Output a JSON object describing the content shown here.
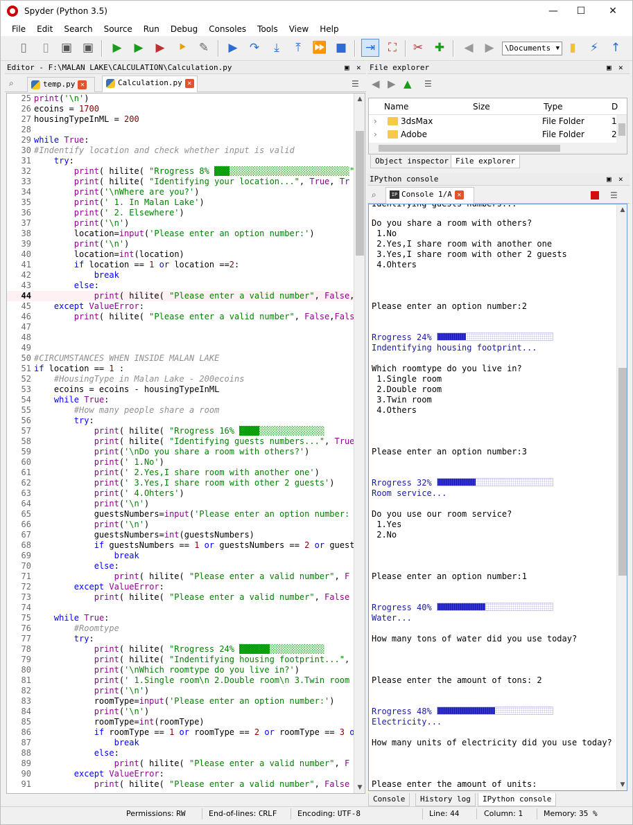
{
  "window": {
    "title": "Spyder (Python 3.5)"
  },
  "menu": [
    "File",
    "Edit",
    "Search",
    "Source",
    "Run",
    "Debug",
    "Consoles",
    "Tools",
    "View",
    "Help"
  ],
  "toolbar": {
    "path_value": "\\Documents"
  },
  "editor": {
    "pane_title": "Editor - F:\\MALAN LAKE\\CALCULATION\\Calculation.py",
    "tabs": [
      {
        "label": "temp.py"
      },
      {
        "label": "Calculation.py"
      }
    ],
    "current_line": 44,
    "lines": [
      {
        "n": "25",
        "html": "<span style='color:#900090'>print</span>(<span style='color:#008000'>'\\n'</span>)"
      },
      {
        "n": "26",
        "html": "ecoins = <span style='color:#800000'>1700</span>"
      },
      {
        "n": "27",
        "html": "housingTypeInML = <span style='color:#800000'>200</span>"
      },
      {
        "n": "28",
        "html": ""
      },
      {
        "n": "29",
        "html": "<span style='color:#0000ff'>while</span> <span style='color:#900090'>True</span>:"
      },
      {
        "n": "30",
        "html": "<span style='color:#909090;font-style:italic'>#Indentify location and check whether input is valid</span>"
      },
      {
        "n": "31",
        "html": "    <span style='color:#0000ff'>try</span>:"
      },
      {
        "n": "32",
        "html": "        <span style='color:#900090'>print</span>( hilite( <span style='color:#008000'>\"Rrogress 8% <span style='background:#19c019'>▒▒▒</span><span style='background:#d6f3d6'>░░░░░░░░░░░░░░░░░░░░░░░░</span>\"</span>, <span style='color:#900090'>T</span>"
      },
      {
        "n": "33",
        "html": "        <span style='color:#900090'>print</span>( hilite( <span style='color:#008000'>\"Identifying your location...\"</span>, <span style='color:#900090'>True</span>, <span style='color:#900090'>Tr</span>"
      },
      {
        "n": "34",
        "html": "        <span style='color:#900090'>print</span>(<span style='color:#008000'>'\\nWhere are you?'</span>)"
      },
      {
        "n": "35",
        "html": "        <span style='color:#900090'>print</span>(<span style='color:#008000'>' 1. In Malan Lake'</span>)"
      },
      {
        "n": "36",
        "html": "        <span style='color:#900090'>print</span>(<span style='color:#008000'>' 2. Elsewhere'</span>)"
      },
      {
        "n": "37",
        "html": "        <span style='color:#900090'>print</span>(<span style='color:#008000'>'\\n'</span>)"
      },
      {
        "n": "38",
        "html": "        location=<span style='color:#900090'>input</span>(<span style='color:#008000'>'Please enter an option number:'</span>)"
      },
      {
        "n": "39",
        "html": "        <span style='color:#900090'>print</span>(<span style='color:#008000'>'\\n'</span>)"
      },
      {
        "n": "40",
        "html": "        location=<span style='color:#900090'>int</span>(location)"
      },
      {
        "n": "41",
        "html": "        <span style='color:#0000ff'>if</span> location == <span style='color:#800000'>1</span> <span style='color:#0000ff'>or</span> location ==<span style='color:#800000'>2</span>:"
      },
      {
        "n": "42",
        "html": "            <span style='color:#0000ff'>break</span>"
      },
      {
        "n": "43",
        "html": "        <span style='color:#0000ff'>else</span>:"
      },
      {
        "n": "44",
        "html": "            <span style='color:#900090'>print</span>( hilite( <span style='color:#008000'>\"Please enter a valid number\"</span>, <span style='color:#900090'>False</span>,"
      },
      {
        "n": "45",
        "html": "    <span style='color:#0000ff'>except</span> <span style='color:#900090'>ValueError</span>:"
      },
      {
        "n": "46",
        "html": "        <span style='color:#900090'>print</span>( hilite( <span style='color:#008000'>\"Please enter a valid number\"</span>, <span style='color:#900090'>False</span>,<span style='color:#900090'>Fals</span>"
      },
      {
        "n": "47",
        "html": ""
      },
      {
        "n": "48",
        "html": ""
      },
      {
        "n": "49",
        "html": ""
      },
      {
        "n": "50",
        "html": "<span style='color:#909090;font-style:italic'>#CIRCUMSTANCES WHEN INSIDE MALAN LAKE</span>"
      },
      {
        "n": "51",
        "html": "<span style='color:#0000ff'>if</span> location == <span style='color:#800000'>1</span> :"
      },
      {
        "n": "52",
        "html": "    <span style='color:#909090;font-style:italic'>#HousingType in Malan Lake - 200ecoins</span>"
      },
      {
        "n": "53",
        "html": "    ecoins = ecoins - housingTypeInML"
      },
      {
        "n": "54",
        "html": "    <span style='color:#0000ff'>while</span> <span style='color:#900090'>True</span>:"
      },
      {
        "n": "55",
        "html": "        <span style='color:#909090;font-style:italic'>#How many people share a room</span>"
      },
      {
        "n": "56",
        "html": "        <span style='color:#0000ff'>try</span>:"
      },
      {
        "n": "57",
        "html": "            <span style='color:#900090'>print</span>( hilite( <span style='color:#008000'>\"Rrogress 16% <span style='background:#19c019'>▒▒▒▒</span><span style='background:#d6f3d6'>░░░░░░░░░░░░░</span></span>"
      },
      {
        "n": "58",
        "html": "            <span style='color:#900090'>print</span>( hilite( <span style='color:#008000'>\"Identifying guests numbers...\"</span>, <span style='color:#900090'>True</span>"
      },
      {
        "n": "59",
        "html": "            <span style='color:#900090'>print</span>(<span style='color:#008000'>'\\nDo you share a room with others?'</span>)"
      },
      {
        "n": "60",
        "html": "            <span style='color:#900090'>print</span>(<span style='color:#008000'>' 1.No'</span>)"
      },
      {
        "n": "61",
        "html": "            <span style='color:#900090'>print</span>(<span style='color:#008000'>' 2.Yes,I share room with another one'</span>)"
      },
      {
        "n": "62",
        "html": "            <span style='color:#900090'>print</span>(<span style='color:#008000'>' 3.Yes,I share room with other 2 guests'</span>)"
      },
      {
        "n": "63",
        "html": "            <span style='color:#900090'>print</span>(<span style='color:#008000'>' 4.Ohters'</span>)"
      },
      {
        "n": "64",
        "html": "            <span style='color:#900090'>print</span>(<span style='color:#008000'>'\\n'</span>)"
      },
      {
        "n": "65",
        "html": "            guestsNumbers=<span style='color:#900090'>input</span>(<span style='color:#008000'>'Please enter an option number:</span>"
      },
      {
        "n": "66",
        "html": "            <span style='color:#900090'>print</span>(<span style='color:#008000'>'\\n'</span>)"
      },
      {
        "n": "67",
        "html": "            guestsNumbers=<span style='color:#900090'>int</span>(guestsNumbers)"
      },
      {
        "n": "68",
        "html": "            <span style='color:#0000ff'>if</span> guestsNumbers == <span style='color:#800000'>1</span> <span style='color:#0000ff'>or</span> guestsNumbers == <span style='color:#800000'>2</span> <span style='color:#0000ff'>or</span> guest"
      },
      {
        "n": "69",
        "html": "                <span style='color:#0000ff'>break</span>"
      },
      {
        "n": "70",
        "html": "            <span style='color:#0000ff'>else</span>:"
      },
      {
        "n": "71",
        "html": "                <span style='color:#900090'>print</span>( hilite( <span style='color:#008000'>\"Please enter a valid number\"</span>, <span style='color:#900090'>F</span>"
      },
      {
        "n": "72",
        "html": "        <span style='color:#0000ff'>except</span> <span style='color:#900090'>ValueError</span>:"
      },
      {
        "n": "73",
        "html": "            <span style='color:#900090'>print</span>( hilite( <span style='color:#008000'>\"Please enter a valid number\"</span>, <span style='color:#900090'>False</span>"
      },
      {
        "n": "74",
        "html": ""
      },
      {
        "n": "75",
        "html": "    <span style='color:#0000ff'>while</span> <span style='color:#900090'>True</span>:"
      },
      {
        "n": "76",
        "html": "        <span style='color:#909090;font-style:italic'>#Roomtype</span>"
      },
      {
        "n": "77",
        "html": "        <span style='color:#0000ff'>try</span>:"
      },
      {
        "n": "78",
        "html": "            <span style='color:#900090'>print</span>( hilite( <span style='color:#008000'>\"Rrogress 24% <span style='background:#19c019'>▒▒▒▒▒▒</span><span style='background:#d6f3d6'>░░░░░░░░░░░</span></span>"
      },
      {
        "n": "79",
        "html": "            <span style='color:#900090'>print</span>( hilite( <span style='color:#008000'>\"Indentifying housing footprint...\"</span>, <span style='color:#900090'>T</span>"
      },
      {
        "n": "80",
        "html": "            <span style='color:#900090'>print</span>(<span style='color:#008000'>'\\nWhich roomtype do you live in?'</span>)"
      },
      {
        "n": "81",
        "html": "            <span style='color:#900090'>print</span>(<span style='color:#008000'>' 1.Single room\\n 2.Double room\\n 3.Twin room</span>"
      },
      {
        "n": "82",
        "html": "            <span style='color:#900090'>print</span>(<span style='color:#008000'>'\\n'</span>)"
      },
      {
        "n": "83",
        "html": "            roomType=<span style='color:#900090'>input</span>(<span style='color:#008000'>'Please enter an option number:'</span>)"
      },
      {
        "n": "84",
        "html": "            <span style='color:#900090'>print</span>(<span style='color:#008000'>'\\n'</span>)"
      },
      {
        "n": "85",
        "html": "            roomType=<span style='color:#900090'>int</span>(roomType)"
      },
      {
        "n": "86",
        "html": "            <span style='color:#0000ff'>if</span> roomType == <span style='color:#800000'>1</span> <span style='color:#0000ff'>or</span> roomType == <span style='color:#800000'>2</span> <span style='color:#0000ff'>or</span> roomType == <span style='color:#800000'>3</span> <span style='color:#0000ff'>o</span>"
      },
      {
        "n": "87",
        "html": "                <span style='color:#0000ff'>break</span>"
      },
      {
        "n": "88",
        "html": "            <span style='color:#0000ff'>else</span>:"
      },
      {
        "n": "89",
        "html": "                <span style='color:#900090'>print</span>( hilite( <span style='color:#008000'>\"Please enter a valid number\"</span>, <span style='color:#900090'>F</span>"
      },
      {
        "n": "90",
        "html": "        <span style='color:#0000ff'>except</span> <span style='color:#900090'>ValueError</span>:"
      },
      {
        "n": "91",
        "html": "            <span style='color:#900090'>print</span>( hilite( <span style='color:#008000'>\"Please enter a valid number\"</span>, <span style='color:#900090'>False</span>"
      }
    ]
  },
  "file_explorer": {
    "pane_title": "File explorer",
    "columns": [
      "Name",
      "Size",
      "Type",
      "D"
    ],
    "rows": [
      {
        "name": "3dsMax",
        "size": "",
        "type": "File Folder",
        "date": "1"
      },
      {
        "name": "Adobe",
        "size": "",
        "type": "File Folder",
        "date": "2"
      }
    ],
    "tabs": [
      "Object inspector",
      "File explorer"
    ]
  },
  "ipython": {
    "pane_title": "IPython console",
    "tab_label": "Console 1/A",
    "top_partial": "Identifying guests numbers...",
    "lines": [
      {
        "t": "Do you share a room with others?"
      },
      {
        "t": " 1.No"
      },
      {
        "t": " 2.Yes,I share room with another one"
      },
      {
        "t": " 3.Yes,I share room with other 2 guests"
      },
      {
        "t": " 4.Ohters"
      },
      {
        "t": ""
      },
      {
        "t": ""
      },
      {
        "t": ""
      },
      {
        "t": "Please enter an option number:2"
      },
      {
        "t": ""
      },
      {
        "t": ""
      },
      {
        "t": "Rrogress 24% ",
        "progress": 0.24,
        "blue": true
      },
      {
        "t": "Indentifying housing footprint...",
        "blue": true
      },
      {
        "t": ""
      },
      {
        "t": "Which roomtype do you live in?"
      },
      {
        "t": " 1.Single room"
      },
      {
        "t": " 2.Double room"
      },
      {
        "t": " 3.Twin room"
      },
      {
        "t": " 4.Others"
      },
      {
        "t": ""
      },
      {
        "t": ""
      },
      {
        "t": ""
      },
      {
        "t": "Please enter an option number:3"
      },
      {
        "t": ""
      },
      {
        "t": ""
      },
      {
        "t": "Rrogress 32% ",
        "progress": 0.32,
        "blue": true
      },
      {
        "t": "Room service...",
        "blue": true
      },
      {
        "t": ""
      },
      {
        "t": "Do you use our room service?"
      },
      {
        "t": " 1.Yes"
      },
      {
        "t": " 2.No"
      },
      {
        "t": ""
      },
      {
        "t": ""
      },
      {
        "t": ""
      },
      {
        "t": "Please enter an option number:1"
      },
      {
        "t": ""
      },
      {
        "t": ""
      },
      {
        "t": "Rrogress 40% ",
        "progress": 0.4,
        "blue": true
      },
      {
        "t": "Water...",
        "blue": true
      },
      {
        "t": ""
      },
      {
        "t": "How many tons of water did you use today?"
      },
      {
        "t": ""
      },
      {
        "t": ""
      },
      {
        "t": ""
      },
      {
        "t": "Please enter the amount of tons: 2"
      },
      {
        "t": ""
      },
      {
        "t": ""
      },
      {
        "t": "Rrogress 48% ",
        "progress": 0.48,
        "blue": true
      },
      {
        "t": "Electricity...",
        "blue": true
      },
      {
        "t": ""
      },
      {
        "t": "How many units of electricity did you use today?"
      },
      {
        "t": ""
      },
      {
        "t": ""
      },
      {
        "t": ""
      },
      {
        "t": "Please enter the amount of units:"
      }
    ],
    "bottom_tabs": [
      "Console",
      "History log",
      "IPython console"
    ]
  },
  "status": {
    "permissions_label": "Permissions:",
    "permissions": "RW",
    "eol_label": "End-of-lines:",
    "eol": "CRLF",
    "encoding_label": "Encoding:",
    "encoding": "UTF-8",
    "line_label": "Line:",
    "line": "44",
    "column_label": "Column:",
    "column": "1",
    "memory_label": "Memory:",
    "memory": "35 %"
  },
  "colors": {
    "accent": "#2222cc",
    "console_border": "#6a9ad8",
    "current_line": "#fdf1f3"
  },
  "icons": [
    "new-file-icon",
    "open-file-icon",
    "save-icon",
    "save-all-icon",
    "run-icon",
    "run-cell-icon",
    "run-cell-advance-icon",
    "run-selection-icon",
    "configure-icon",
    "debug-icon",
    "step-icon",
    "step-into-icon",
    "step-return-icon",
    "continue-icon",
    "stop-debug-icon",
    "maximize-pane-icon",
    "fullscreen-icon",
    "preferences-icon",
    "python-path-icon",
    "back-icon",
    "forward-icon",
    "folder-icon",
    "python-icon",
    "up-icon"
  ]
}
